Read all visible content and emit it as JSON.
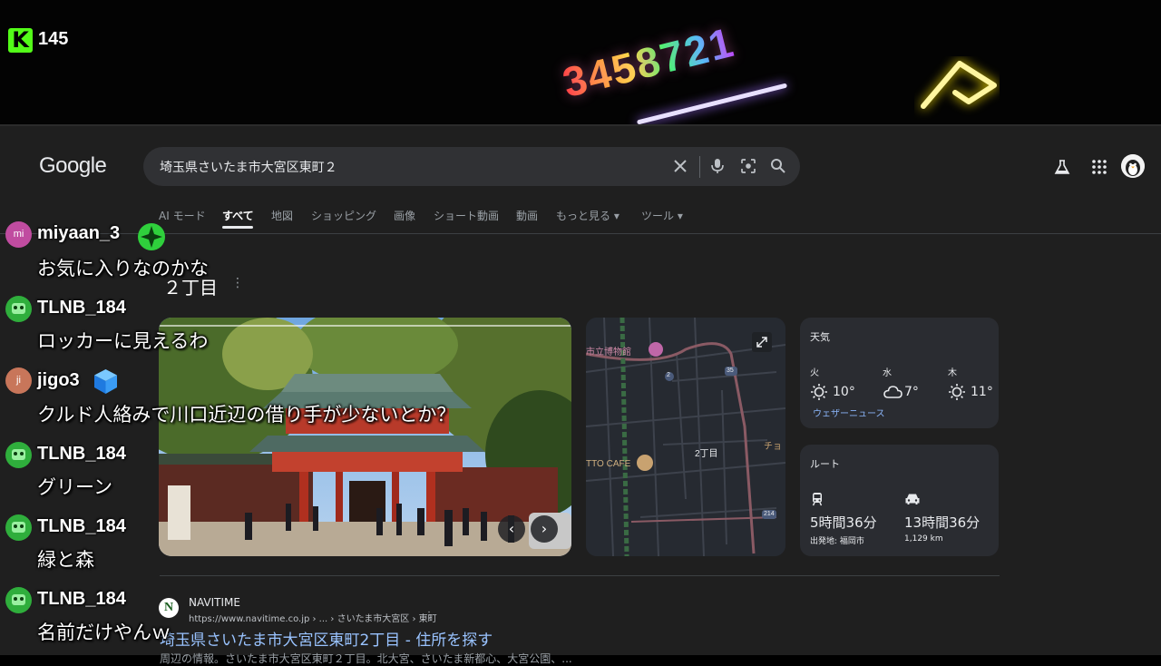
{
  "stream": {
    "viewer_count": "145",
    "logo_letter": "K",
    "neon_number": "3458721"
  },
  "google": {
    "logo": "Google",
    "search_query": "埼玉県さいたま市大宮区東町２",
    "tabs": [
      "AI モード",
      "すべて",
      "地図",
      "ショッピング",
      "画像",
      "ショート動画",
      "動画",
      "もっと見る ▾",
      "ツール ▾"
    ],
    "active_tab": "すべて",
    "heading": "２丁目",
    "map": {
      "labels": [
        "市立博物館",
        "2丁目",
        "TTO CAFE",
        "チョ",
        "35",
        "2",
        "214"
      ]
    },
    "weather": {
      "title": "天気",
      "days": [
        {
          "day": "火",
          "icon": "sun-icon",
          "temp": "10°"
        },
        {
          "day": "水",
          "icon": "cloud-icon",
          "temp": "7°"
        },
        {
          "day": "木",
          "icon": "sun-icon",
          "temp": "11°"
        }
      ],
      "source_link": "ウェザーニュース"
    },
    "route": {
      "title": "ルート",
      "transit_time": "5時間36分",
      "transit_origin": "出発地: 福岡市",
      "car_time": "13時間36分",
      "car_distance": "1,129 km"
    },
    "result": {
      "favicon_letter": "N",
      "site_name": "NAVITIME",
      "url": "https://www.navitime.co.jp › ... › さいたま市大宮区 › 東町",
      "title": "埼玉県さいたま市大宮区東町2丁目 - 住所を探す",
      "snippet": "周辺の情報。さいたま市大宮区東町２丁目。北大宮、さいたま新都心、大宮公園、... "
    }
  },
  "chat": [
    {
      "user": "miyaan_3",
      "badge": "mi",
      "badge_color": "#c04ca0",
      "text": "お気に入りなのかな",
      "has_badge_icon": true
    },
    {
      "user": "TLNB_184",
      "badge": "",
      "badge_color": "#2fae3c",
      "text": "ロッカーに見えるわ",
      "has_badge_icon": false
    },
    {
      "user": "jigo3",
      "badge": "ji",
      "badge_color": "#c8765a",
      "text": "クルド人絡みで川口近辺の借り手が少ないとか？",
      "has_badge_icon": true
    },
    {
      "user": "TLNB_184",
      "badge": "",
      "badge_color": "#2fae3c",
      "text": "グリーン",
      "has_badge_icon": false
    },
    {
      "user": "TLNB_184",
      "badge": "",
      "badge_color": "#2fae3c",
      "text": "緑と森",
      "has_badge_icon": false
    },
    {
      "user": "TLNB_184",
      "badge": "",
      "badge_color": "#2fae3c",
      "text": "名前だけやんｗ",
      "has_badge_icon": false
    }
  ]
}
